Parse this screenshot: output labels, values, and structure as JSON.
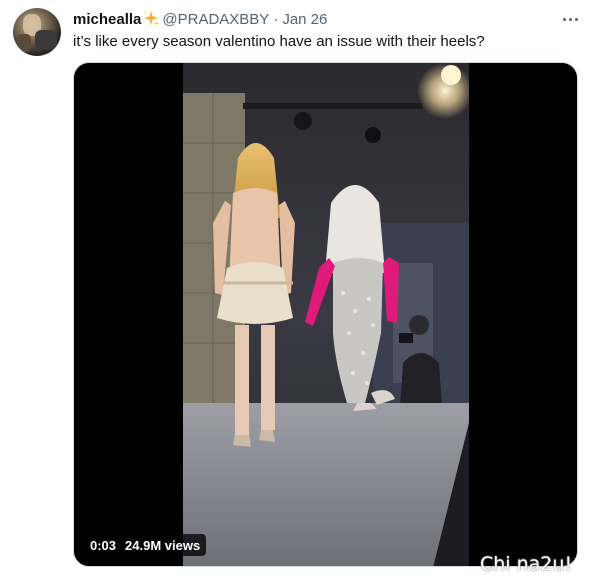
{
  "user": {
    "display_name": "michealla",
    "emoji_icon": "sparkles-icon",
    "handle": "@PRADAXBBY",
    "separator": "·",
    "date": "Jan 26"
  },
  "tweet": {
    "text": "it’s like every season valentino have an issue with their heels?"
  },
  "media": {
    "type": "video",
    "elapsed": "0:03",
    "views": "24.9M views"
  },
  "watermark": {
    "text": "Chi na2u!"
  },
  "colors": {
    "text_primary": "#0f1419",
    "text_secondary": "#536471",
    "sparkle": "#ffac33",
    "gloves": "#e01a7a"
  }
}
